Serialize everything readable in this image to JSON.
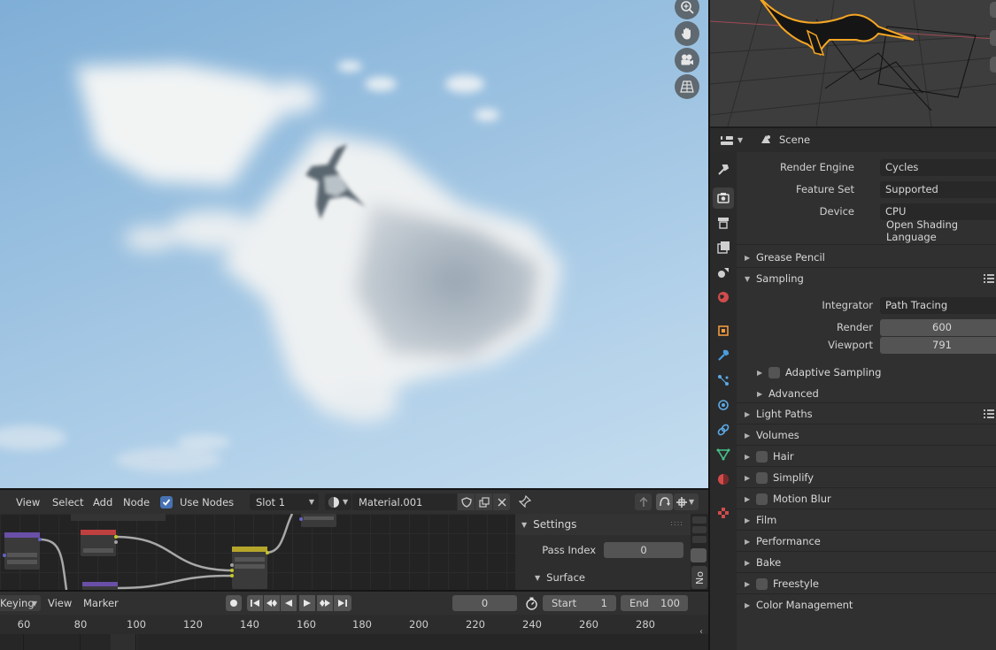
{
  "viewport": {
    "nav_buttons": [
      "zoom-icon",
      "hand-pan-icon",
      "camera-icon",
      "grid-perspective-icon"
    ]
  },
  "properties": {
    "header_title": "Scene",
    "tabs": [
      "tool-icon",
      "render-icon",
      "output-icon",
      "view-layer-icon",
      "scene-icon",
      "world-icon",
      "object-icon",
      "modifier-icon",
      "particles-icon",
      "physics-icon",
      "constraints-icon",
      "data-icon",
      "material-icon",
      "texture-icon"
    ],
    "render_engine": {
      "label": "Render Engine",
      "value": "Cycles"
    },
    "feature_set": {
      "label": "Feature Set",
      "value": "Supported"
    },
    "device": {
      "label": "Device",
      "value": "CPU"
    },
    "osl": "Open Shading Language",
    "panels": {
      "grease_pencil": "Grease Pencil",
      "sampling": "Sampling",
      "integrator": {
        "label": "Integrator",
        "value": "Path Tracing"
      },
      "render": {
        "label": "Render",
        "value": "600"
      },
      "viewport": {
        "label": "Viewport",
        "value": "791"
      },
      "adaptive_sampling": "Adaptive Sampling",
      "advanced": "Advanced",
      "light_paths": "Light Paths",
      "volumes": "Volumes",
      "hair": "Hair",
      "simplify": "Simplify",
      "motion_blur": "Motion Blur",
      "film": "Film",
      "performance": "Performance",
      "bake": "Bake",
      "freestyle": "Freestyle",
      "color_management": "Color Management"
    }
  },
  "node_editor": {
    "menus": {
      "view": "View",
      "select": "Select",
      "add": "Add",
      "node": "Node"
    },
    "use_nodes": "Use Nodes",
    "slot": "Slot 1",
    "material": "Material.001",
    "settings_title": "Settings",
    "pass_index": {
      "label": "Pass Index",
      "value": "0"
    },
    "surface": "Surface",
    "side_tab": "No"
  },
  "timeline": {
    "keying": "Keying",
    "view": "View",
    "marker": "Marker",
    "current_frame": "0",
    "start": {
      "label": "Start",
      "value": "1"
    },
    "end": {
      "label": "End",
      "value": "100"
    },
    "ruler": [
      "60",
      "80",
      "100",
      "120",
      "140",
      "160",
      "180",
      "200",
      "220",
      "240",
      "260",
      "280"
    ]
  },
  "colors": {
    "accent_blue": "#4772b3",
    "object_outline": "#f5a623",
    "sky": "#9fc4e2"
  }
}
